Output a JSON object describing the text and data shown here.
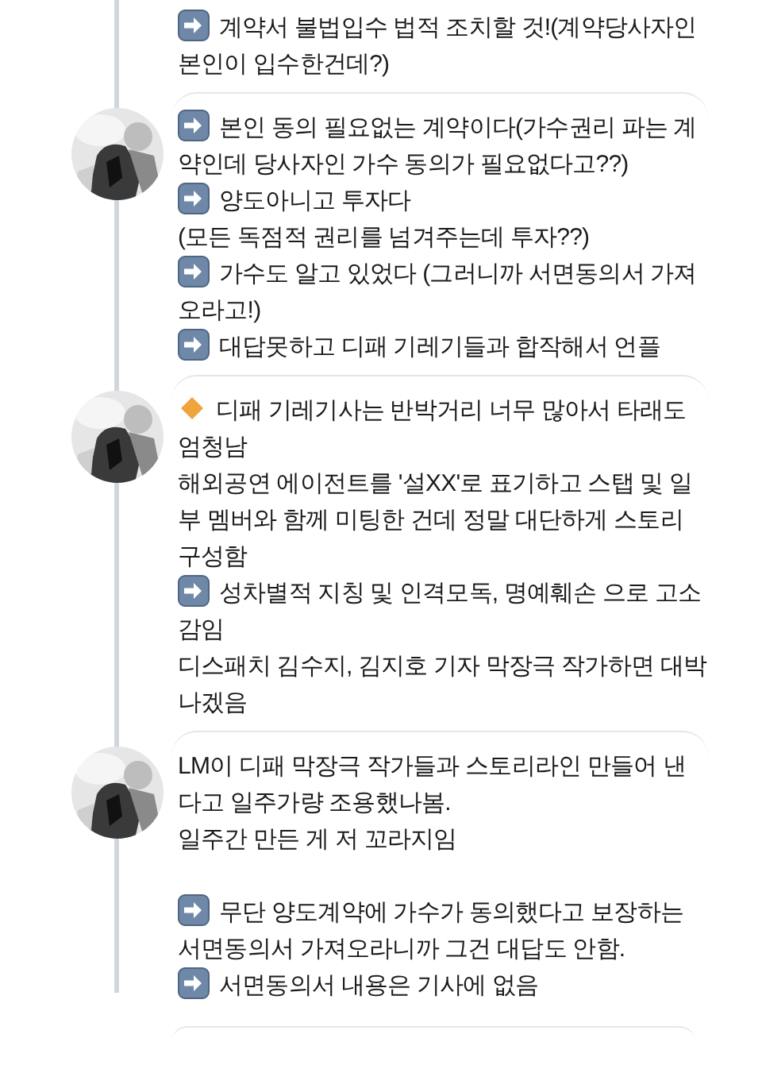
{
  "posts": [
    {
      "avatar": false,
      "blocks": [
        {
          "paragraphs": [
            {
              "kind": "arrow",
              "text": "계약서 불법입수 법적 조치할 것!(계약당사자인 본인이 입수한건데?)"
            }
          ]
        }
      ]
    },
    {
      "avatar": true,
      "blocks": [
        {
          "paragraphs": [
            {
              "kind": "arrow",
              "text": "본인 동의 필요없는 계약이다(가수권리 파는 계약인데 당사자인 가수 동의가 필요없다고??)"
            },
            {
              "kind": "arrow",
              "text": "양도아니고 투자다"
            },
            {
              "kind": "plain",
              "text": "(모든 독점적 권리를 넘겨주는데 투자??)"
            },
            {
              "kind": "arrow",
              "text": "가수도 알고 있었다 (그러니까 서면동의서 가져오라고!)"
            },
            {
              "kind": "arrow",
              "text": "대답못하고 디패 기레기들과 합작해서 언플"
            }
          ]
        }
      ]
    },
    {
      "avatar": true,
      "blocks": [
        {
          "paragraphs": [
            {
              "kind": "diamond",
              "text": "디패 기레기사는 반박거리 너무 많아서 타래도 엄청남"
            },
            {
              "kind": "plain",
              "text": "해외공연 에이전트를 '설XX'로 표기하고 스탭 및 일부 멤버와 함께 미팅한 건데 정말 대단하게 스토리 구성함"
            },
            {
              "kind": "arrow",
              "text": "성차별적 지칭 및 인격모독, 명예훼손 으로 고소감임"
            },
            {
              "kind": "plain",
              "text": "디스패치 김수지, 김지호 기자 막장극 작가하면 대박나겠음"
            }
          ]
        }
      ]
    },
    {
      "avatar": true,
      "blocks": [
        {
          "paragraphs": [
            {
              "kind": "plain",
              "text": "LM이 디패 막장극 작가들과 스토리라인 만들어 낸다고 일주가량 조용했나봄."
            },
            {
              "kind": "plain",
              "text": "일주간 만든 게 저 꼬라지임"
            }
          ]
        },
        {
          "paragraphs": [
            {
              "kind": "arrow",
              "text": "무단 양도계약에 가수가 동의했다고 보장하는 서면동의서 가져오라니까 그건 대답도 안함."
            },
            {
              "kind": "arrow",
              "text": "서면동의서 내용은 기사에 없음"
            }
          ]
        }
      ]
    }
  ]
}
